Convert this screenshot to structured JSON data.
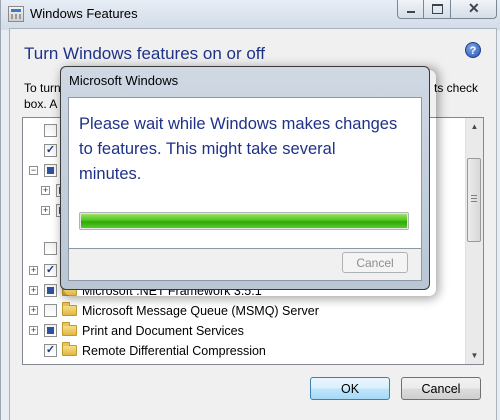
{
  "window": {
    "title": "Windows Features"
  },
  "main": {
    "heading": "Turn Windows features on or off",
    "description_left": "To turn",
    "description_left2": "box. A",
    "description_right": "ts check"
  },
  "tree": {
    "items": [
      {
        "checkbox": "unchecked",
        "label": ""
      },
      {
        "checkbox": "checked",
        "label": ""
      },
      {
        "checkbox": "partial",
        "label": ""
      },
      {
        "checkbox": "partial",
        "label": ""
      },
      {
        "checkbox": "partial",
        "label": ""
      },
      {
        "checkbox": "unchecked",
        "label": ""
      },
      {
        "checkbox": "checked",
        "label": ""
      },
      {
        "checkbox": "partial",
        "label": "Microsoft .NET Framework 3.5.1"
      },
      {
        "checkbox": "unchecked",
        "label": "Microsoft Message Queue (MSMQ) Server"
      },
      {
        "checkbox": "partial",
        "label": "Print and Document Services"
      },
      {
        "checkbox": "checked",
        "label": "Remote Differential Compression"
      }
    ]
  },
  "buttons": {
    "ok": "OK",
    "cancel": "Cancel"
  },
  "dialog": {
    "title": "Microsoft Windows",
    "message": "Please wait while Windows makes changes to features. This might take several minutes.",
    "progress_fraction": 1.0,
    "cancel": "Cancel"
  },
  "icons": {
    "app": "windows-features-icon",
    "help": "help-icon",
    "folder": "folder-icon"
  },
  "colors": {
    "heading": "#1e3287",
    "progress": "#4fc61a"
  }
}
